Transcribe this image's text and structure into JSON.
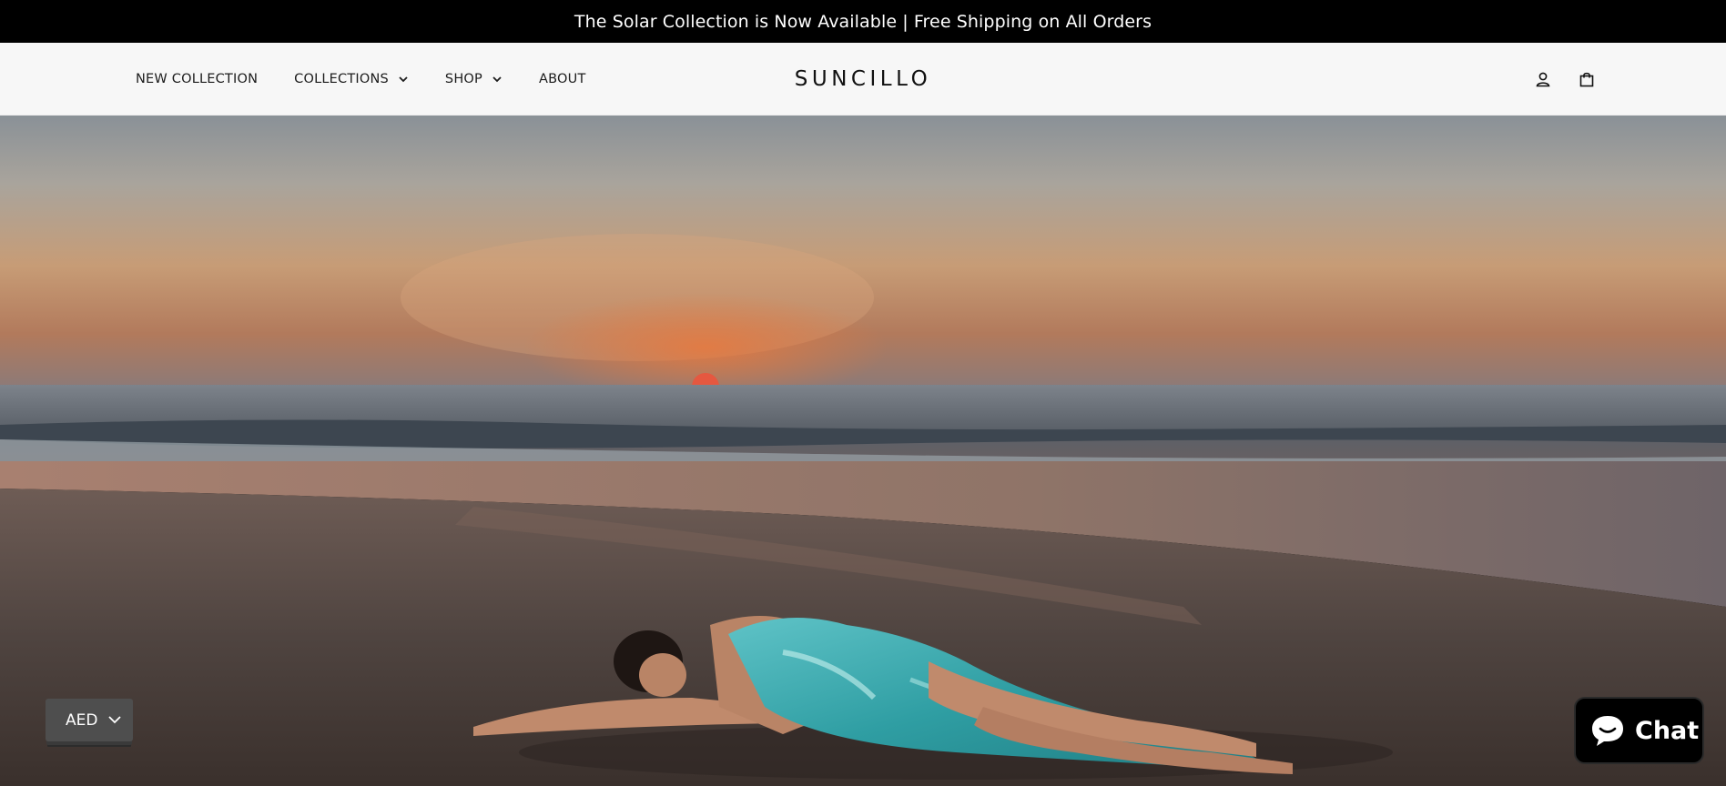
{
  "announcement": "The Solar Collection is Now Available | Free Shipping on All Orders",
  "header": {
    "nav": [
      {
        "label": "NEW COLLECTION"
      },
      {
        "label": "COLLECTIONS"
      },
      {
        "label": "SHOP"
      },
      {
        "label": "ABOUT"
      }
    ],
    "logo": "SUNCILLO",
    "icons": [
      "account-icon",
      "bag-icon"
    ]
  },
  "hero": {
    "image": "sunset-beach-model-photo"
  },
  "currency_selector": {
    "value": "AED"
  },
  "chat": {
    "label": "Chat",
    "icon": "chat-bubble-icon"
  },
  "colors": {
    "announcement_bg": "#000000",
    "header_bg": "#f7f7f7",
    "currency_bg": "#4e4e4e",
    "chat_bg": "#000000"
  }
}
